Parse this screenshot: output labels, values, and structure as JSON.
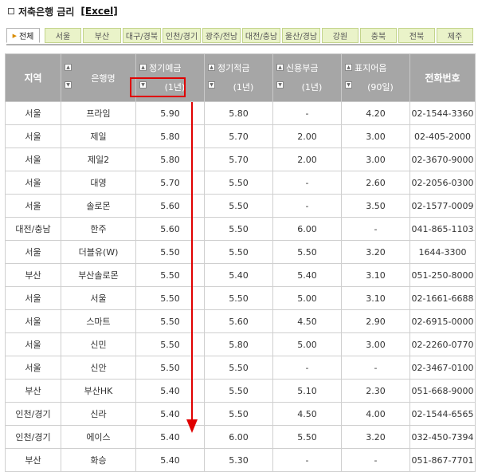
{
  "header": {
    "title": "저축은행 금리",
    "excel_label": "[Excel]"
  },
  "tabs": [
    {
      "label": "전체",
      "active": true
    },
    {
      "label": "서울"
    },
    {
      "label": "부산"
    },
    {
      "label": "대구/경북"
    },
    {
      "label": "인천/경기"
    },
    {
      "label": "광주/전남"
    },
    {
      "label": "대전/충남"
    },
    {
      "label": "울산/경남"
    },
    {
      "label": "강원"
    },
    {
      "label": "충북"
    },
    {
      "label": "전북"
    },
    {
      "label": "제주"
    }
  ],
  "table": {
    "headers": {
      "region": "지역",
      "bank": "은행명",
      "deposit": {
        "line1": "정기예금",
        "line2": "(1년)"
      },
      "installment": {
        "line1": "정기적금",
        "line2": "(1년)"
      },
      "credit": {
        "line1": "신용부금",
        "line2": "(1년)"
      },
      "note": {
        "line1": "표지어음",
        "line2": "(90일)"
      },
      "phone": "전화번호"
    },
    "rows": [
      [
        "서울",
        "프라임",
        "5.90",
        "5.80",
        "-",
        "4.20",
        "02-1544-3360"
      ],
      [
        "서울",
        "제일",
        "5.80",
        "5.70",
        "2.00",
        "3.00",
        "02-405-2000"
      ],
      [
        "서울",
        "제일2",
        "5.80",
        "5.70",
        "2.00",
        "3.00",
        "02-3670-9000"
      ],
      [
        "서울",
        "대영",
        "5.70",
        "5.50",
        "-",
        "2.60",
        "02-2056-0300"
      ],
      [
        "서울",
        "솔로몬",
        "5.60",
        "5.50",
        "-",
        "3.50",
        "02-1577-0009"
      ],
      [
        "대전/충남",
        "한주",
        "5.60",
        "5.50",
        "6.00",
        "-",
        "041-865-1103"
      ],
      [
        "서울",
        "더블유(W)",
        "5.50",
        "5.50",
        "5.50",
        "3.20",
        "1644-3300"
      ],
      [
        "부산",
        "부산솔로몬",
        "5.50",
        "5.40",
        "5.40",
        "3.10",
        "051-250-8000"
      ],
      [
        "서울",
        "서울",
        "5.50",
        "5.50",
        "5.00",
        "3.10",
        "02-1661-6688"
      ],
      [
        "서울",
        "스마트",
        "5.50",
        "5.60",
        "4.50",
        "2.90",
        "02-6915-0000"
      ],
      [
        "서울",
        "신민",
        "5.50",
        "5.80",
        "5.00",
        "3.00",
        "02-2260-0770"
      ],
      [
        "서울",
        "신안",
        "5.50",
        "5.50",
        "-",
        "-",
        "02-3467-0100"
      ],
      [
        "부산",
        "부산HK",
        "5.40",
        "5.50",
        "5.10",
        "2.30",
        "051-668-9000"
      ],
      [
        "인천/경기",
        "신라",
        "5.40",
        "5.50",
        "4.50",
        "4.00",
        "02-1544-6565"
      ],
      [
        "인천/경기",
        "에이스",
        "5.40",
        "6.00",
        "5.50",
        "3.20",
        "032-450-7394"
      ],
      [
        "부산",
        "화승",
        "5.40",
        "5.30",
        "-",
        "-",
        "051-867-7701"
      ]
    ]
  },
  "colors": {
    "header_bg": "#a6a6a6",
    "tab_bg": "#eaf3c9",
    "annotation": "#e00000"
  }
}
